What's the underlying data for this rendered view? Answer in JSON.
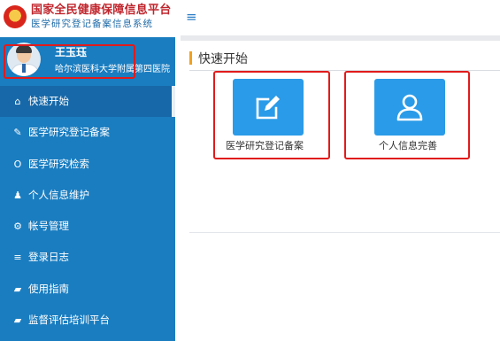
{
  "header": {
    "title": "国家全民健康保障信息平台",
    "subtitle": "医学研究登记备案信息系统",
    "menu_toggle_icon": "≡"
  },
  "user": {
    "name": "王玉珏",
    "org": "哈尔滨医科大学附属第四医院"
  },
  "sidebar": {
    "items": [
      {
        "label": "快速开始",
        "icon": "home-icon",
        "glyph": "⌂",
        "active": true
      },
      {
        "label": "医学研究登记备案",
        "icon": "pencil-icon",
        "glyph": "✎",
        "active": false
      },
      {
        "label": "医学研究检索",
        "icon": "search-circle-icon",
        "glyph": "O",
        "active": false
      },
      {
        "label": "个人信息维护",
        "icon": "user-icon",
        "glyph": "♟",
        "active": false
      },
      {
        "label": "帐号管理",
        "icon": "gears-icon",
        "glyph": "⚙",
        "active": false
      },
      {
        "label": "登录日志",
        "icon": "list-icon",
        "glyph": "≡",
        "active": false
      },
      {
        "label": "使用指南",
        "icon": "book-icon",
        "glyph": "▰",
        "active": false
      },
      {
        "label": "监督评估培训平台",
        "icon": "book-icon",
        "glyph": "▰",
        "active": false
      }
    ]
  },
  "main": {
    "section_title": "快速开始",
    "tiles": [
      {
        "label": "医学研究登记备案",
        "icon": "edit-icon"
      },
      {
        "label": "个人信息完善",
        "icon": "user-outline-icon"
      }
    ]
  },
  "colors": {
    "sidebar_bg": "#1a7dc0",
    "tile_bg": "#2a9be8",
    "highlight": "#e11b1b",
    "title_red": "#c0262d",
    "accent_orange": "#f0a020"
  }
}
